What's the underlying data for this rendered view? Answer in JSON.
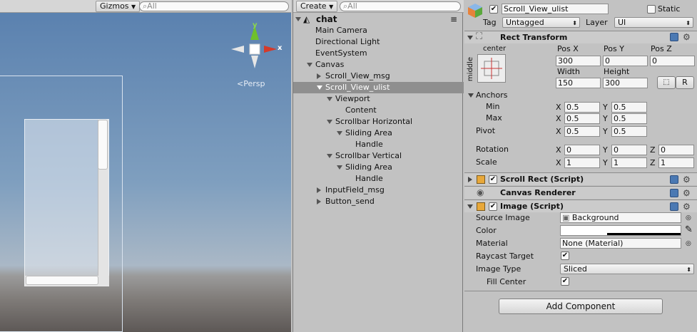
{
  "scene": {
    "gizmos_label": "Gizmos",
    "search_placeholder": "All",
    "gizmo": {
      "y_label": "y",
      "x_label": "x",
      "persp_label": "Persp"
    }
  },
  "hierarchy": {
    "create_label": "Create",
    "search_placeholder": "All",
    "scene_name": "chat",
    "items": [
      {
        "label": "Main Camera",
        "indent": 0,
        "arrow": "none",
        "selected": false
      },
      {
        "label": "Directional Light",
        "indent": 0,
        "arrow": "none",
        "selected": false
      },
      {
        "label": "EventSystem",
        "indent": 0,
        "arrow": "none",
        "selected": false
      },
      {
        "label": "Canvas",
        "indent": 0,
        "arrow": "down",
        "selected": false
      },
      {
        "label": "Scroll_View_msg",
        "indent": 1,
        "arrow": "right",
        "selected": false
      },
      {
        "label": "Scroll_View_ulist",
        "indent": 1,
        "arrow": "down",
        "selected": true
      },
      {
        "label": "Viewport",
        "indent": 2,
        "arrow": "down",
        "selected": false
      },
      {
        "label": "Content",
        "indent": 3,
        "arrow": "none",
        "selected": false
      },
      {
        "label": "Scrollbar Horizontal",
        "indent": 2,
        "arrow": "down",
        "selected": false
      },
      {
        "label": "Sliding Area",
        "indent": 3,
        "arrow": "down",
        "selected": false
      },
      {
        "label": "Handle",
        "indent": 4,
        "arrow": "none",
        "selected": false
      },
      {
        "label": "Scrollbar Vertical",
        "indent": 2,
        "arrow": "down",
        "selected": false
      },
      {
        "label": "Sliding Area",
        "indent": 3,
        "arrow": "down",
        "selected": false
      },
      {
        "label": "Handle",
        "indent": 4,
        "arrow": "none",
        "selected": false
      },
      {
        "label": "InputField_msg",
        "indent": 1,
        "arrow": "right",
        "selected": false
      },
      {
        "label": "Button_send",
        "indent": 1,
        "arrow": "right",
        "selected": false
      }
    ]
  },
  "inspector": {
    "object_name": "Scroll_View_ulist",
    "static_label": "Static",
    "tag_label": "Tag",
    "tag_value": "Untagged",
    "layer_label": "Layer",
    "layer_value": "UI",
    "rect_transform": {
      "title": "Rect Transform",
      "anchor_preset_h": "center",
      "anchor_preset_v": "middle",
      "posx_label": "Pos X",
      "posy_label": "Pos Y",
      "posz_label": "Pos Z",
      "posx": "300",
      "posy": "0",
      "posz": "0",
      "width_label": "Width",
      "height_label": "Height",
      "width": "150",
      "height": "300",
      "raw_button": "R",
      "anchors_label": "Anchors",
      "min_label": "Min",
      "max_label": "Max",
      "min_x": "0.5",
      "min_y": "0.5",
      "max_x": "0.5",
      "max_y": "0.5",
      "pivot_label": "Pivot",
      "pivot_x": "0.5",
      "pivot_y": "0.5",
      "rotation_label": "Rotation",
      "rot_x": "0",
      "rot_y": "0",
      "rot_z": "0",
      "scale_label": "Scale",
      "scale_x": "1",
      "scale_y": "1",
      "scale_z": "1",
      "x": "X",
      "y": "Y",
      "z": "Z"
    },
    "scroll_rect": {
      "title": "Scroll Rect (Script)"
    },
    "canvas_renderer": {
      "title": "Canvas Renderer"
    },
    "image": {
      "title": "Image (Script)",
      "source_image_label": "Source Image",
      "source_image_value": "Background",
      "color_label": "Color",
      "material_label": "Material",
      "material_value": "None (Material)",
      "raycast_label": "Raycast Target",
      "image_type_label": "Image Type",
      "image_type_value": "Sliced",
      "fill_center_label": "Fill Center"
    },
    "add_component_label": "Add Component"
  },
  "colors": {
    "selection": "#8f8f8f",
    "gizmo_x": "#d43a2a",
    "gizmo_y": "#6fc02c",
    "help": "#4b79b3"
  }
}
